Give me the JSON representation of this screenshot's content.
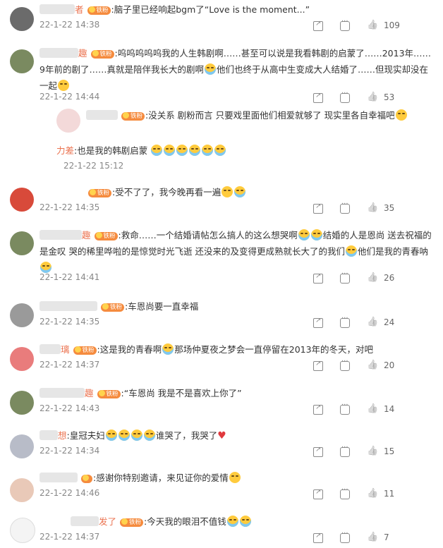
{
  "badge_label": "铁粉",
  "comments": [
    {
      "id": "c1",
      "name": "者",
      "text": ":脑子里已经响起bgm了“Love is the moment...”",
      "time": "22-1-22 14:38",
      "likes": "109"
    },
    {
      "id": "c2",
      "name": "趣",
      "text": ":呜呜呜呜呜我的人生韩剧啊……甚至可以说是我看韩剧的启蒙了……2013年……9年前的剧了……真就是陪伴我长大的剧啊",
      "text2": "他们也终于从高中生变成大人结婚了……但现实却没在一起",
      "time": "22-1-22 14:44",
      "likes": "53"
    },
    {
      "id": "c3",
      "name": "",
      "text": ":没关系 剧粉而言 只要戏里面他们相爱就够了 现实里各自幸福吧"
    },
    {
      "id": "c4",
      "name": "力差",
      "text": ":也是我的韩剧启蒙",
      "time": "22-1-22 15:12"
    },
    {
      "id": "c5",
      "name": "",
      "text": ":受不了了，我今晚再看一遍",
      "time": "22-1-22 14:35",
      "likes": "35"
    },
    {
      "id": "c6",
      "name": "趣",
      "text": ":救命……一个结婚请帖怎么搞人的这么想哭啊",
      "text2": "结婚的人是恩尚 送去祝福的是金叹 哭的稀里哗啦的是惊觉时光飞逝 还没来的及变得更成熟就长大了的我们",
      "text3": "他们是我的青春呐",
      "time": "22-1-22 14:41",
      "likes": "26"
    },
    {
      "id": "c7",
      "name": "",
      "text": ":车恩尚要一直幸福",
      "time": "22-1-22 14:35",
      "likes": "24"
    },
    {
      "id": "c8",
      "name": "璃",
      "text": ":这是我的青春啊",
      "text2": "那场仲夏夜之梦会一直停留在2013年的冬天，对吧",
      "time": "22-1-22 14:37",
      "likes": "20"
    },
    {
      "id": "c9",
      "name": "趣",
      "text": ":“车恩尚 我是不是喜欢上你了”",
      "time": "22-1-22 14:43",
      "likes": "14"
    },
    {
      "id": "c10",
      "name": "想",
      "text": ":皇冠夫妇",
      "text2": "谁哭了，我哭了",
      "time": "22-1-22 14:34",
      "likes": "15"
    },
    {
      "id": "c11",
      "name": "",
      "text": ":感谢你特别邀请，来见证你的爱情",
      "time": "22-1-22 14:46",
      "likes": "11"
    },
    {
      "id": "c12",
      "name": "发了",
      "text": ":今天我的眼泪不值钱",
      "time": "22-1-22 14:37",
      "likes": "7"
    }
  ]
}
